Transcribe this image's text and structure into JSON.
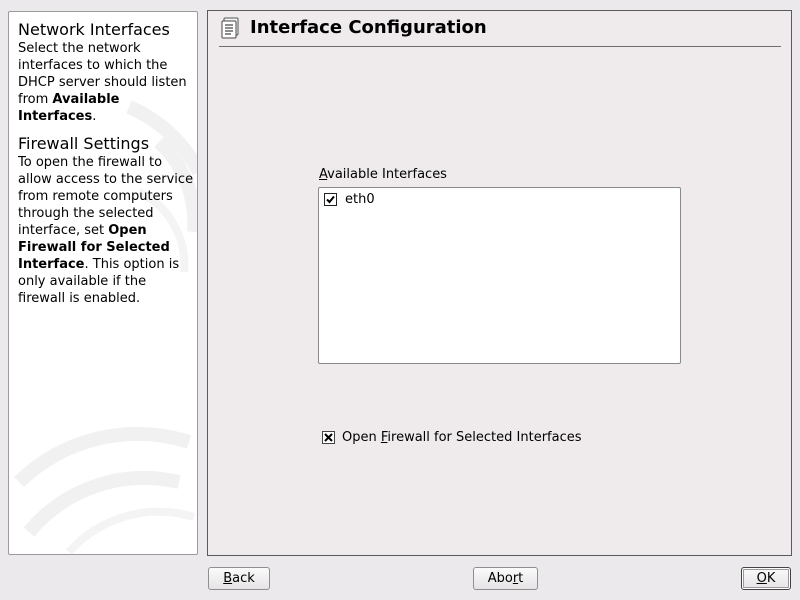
{
  "help": {
    "section1": {
      "heading": "Network Interfaces",
      "text_before": "Select the network interfaces to which the DHCP server should listen from ",
      "bold": "Available Interfaces",
      "text_after": "."
    },
    "section2": {
      "heading": "Firewall Settings",
      "text_before": "To open the firewall to allow access to the service from remote computers through the selected interface, set ",
      "bold": "Open Firewall for Selected Interface",
      "text_after": ". This option is only available if the firewall is enabled."
    }
  },
  "main": {
    "title": "Interface Configuration",
    "title_icon": "document-list-icon",
    "list_label_accel": "A",
    "list_label_rest": "vailable Interfaces",
    "interfaces": [
      {
        "name": "eth0",
        "checked": true
      }
    ],
    "firewall_checkbox": {
      "checked": true,
      "label_before": "Open ",
      "label_accel": "F",
      "label_after": "irewall for Selected Interfaces"
    }
  },
  "buttons": {
    "back": {
      "accel": "B",
      "rest": "ack"
    },
    "abort": {
      "before": "Abo",
      "accel": "r",
      "after": "t"
    },
    "ok": {
      "accel": "O",
      "rest": "K"
    }
  }
}
